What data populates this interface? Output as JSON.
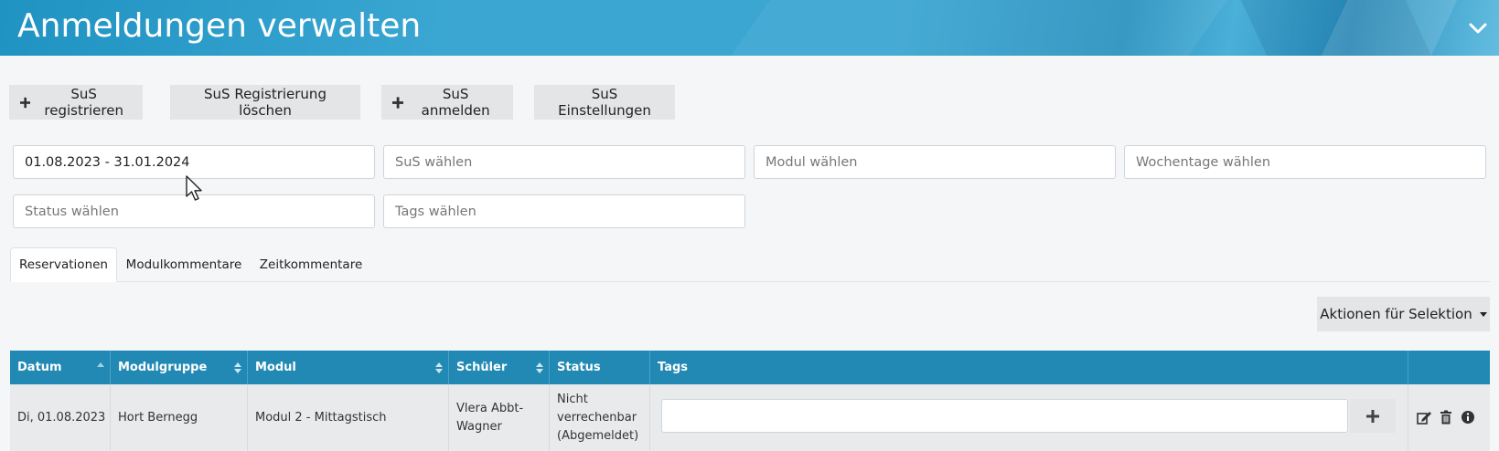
{
  "header": {
    "title": "Anmeldungen verwalten"
  },
  "toolbar": {
    "register_label": "SuS registrieren",
    "delete_registration_label": "SuS Registrierung löschen",
    "enroll_label": "SuS anmelden",
    "settings_label": "SuS Einstellungen"
  },
  "filters": {
    "date_range_value": "01.08.2023 - 31.01.2024",
    "student_placeholder": "SuS wählen",
    "module_placeholder": "Modul wählen",
    "weekdays_placeholder": "Wochentage wählen",
    "status_placeholder": "Status wählen",
    "tags_placeholder": "Tags wählen"
  },
  "tabs": [
    {
      "label": "Reservationen",
      "active": true
    },
    {
      "label": "Modulkommentare",
      "active": false
    },
    {
      "label": "Zeitkommentare",
      "active": false
    }
  ],
  "actions": {
    "label": "Aktionen für Selektion"
  },
  "table": {
    "columns": [
      "Datum",
      "Modulgruppe",
      "Modul",
      "Schüler",
      "Status",
      "Tags"
    ],
    "rows": [
      {
        "datum": "Di, 01.08.2023",
        "modulgruppe": "Hort Bernegg",
        "modul": "Modul 2 - Mittagstisch",
        "schueler_line1": "Vlera Abbt-",
        "schueler_line2": "Wagner",
        "status_line1": "Nicht",
        "status_line2": "verrechenbar",
        "status_line3": "(Abgemeldet)",
        "tags_value": ""
      }
    ]
  },
  "colors": {
    "header": "#3ba6d2",
    "table_header": "#2189b3",
    "button": "#e4e5e7"
  }
}
